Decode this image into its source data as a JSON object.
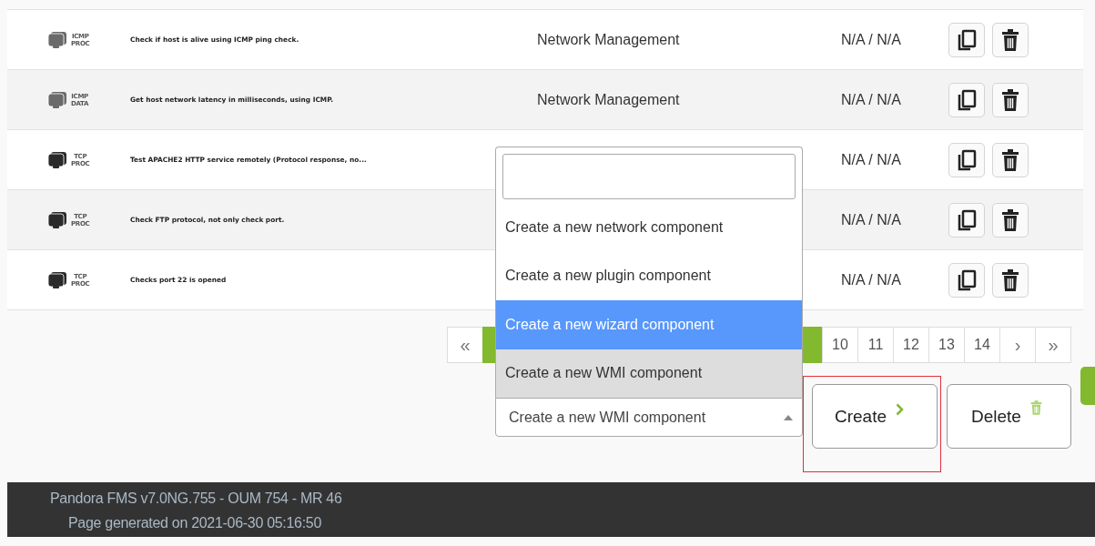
{
  "components": [
    {
      "kind": "icmp",
      "type_top": "ICMP",
      "type_bottom": "PROC",
      "description": "Check if host is alive using ICMP ping check.",
      "group": "Network Management",
      "version": "N/A / N/A"
    },
    {
      "kind": "icmp",
      "type_top": "ICMP",
      "type_bottom": "DATA",
      "description": "Get host network latency in milliseconds, using ICMP.",
      "group": "Network Management",
      "version": "N/A / N/A"
    },
    {
      "kind": "tcp",
      "type_top": "TCP",
      "type_bottom": "PROC",
      "description": "Test APACHE2 HTTP service remotely (Protocol response, no...",
      "version": "N/A / N/A"
    },
    {
      "kind": "tcp",
      "type_top": "TCP",
      "type_bottom": "PROC",
      "description": "Check FTP protocol, not only check port.",
      "version": "N/A / N/A"
    },
    {
      "kind": "tcp",
      "type_top": "TCP",
      "type_bottom": "PROC",
      "description": "Checks port 22 is opened",
      "version": "N/A / N/A"
    }
  ],
  "pagination": [
    {
      "kind": "first",
      "label": "«",
      "selected": false
    },
    {
      "kind": "page",
      "selected": true
    },
    {
      "kind": "page",
      "label": "10",
      "selected": false
    },
    {
      "kind": "page",
      "label": "11",
      "selected": false
    },
    {
      "kind": "page",
      "label": "12",
      "selected": false
    },
    {
      "kind": "page",
      "label": "13",
      "selected": false
    },
    {
      "kind": "page",
      "label": "14",
      "selected": false
    },
    {
      "kind": "next",
      "label": "›",
      "selected": false
    },
    {
      "kind": "last",
      "label": "»",
      "selected": false
    }
  ],
  "create_select": {
    "value": "Create a new WMI component",
    "expanded": true,
    "options": [
      {
        "label": "Create a new network component",
        "highlighted": false,
        "selected": false
      },
      {
        "label": "Create a new plugin component",
        "highlighted": false,
        "selected": false
      },
      {
        "label": "Create a new wizard component",
        "highlighted": true,
        "selected": false
      },
      {
        "label": "Create a new WMI component",
        "highlighted": false,
        "selected": true
      }
    ]
  },
  "buttons": [
    {
      "kind": "create",
      "label": "Create",
      "highlighted": true
    },
    {
      "kind": "delete",
      "label": "Delete",
      "highlighted": false
    }
  ],
  "footer": [
    "Pandora FMS v7.0NG.755 - OUM 754 - MR 46",
    "Page generated on 2021-06-30 05:16:50"
  ]
}
